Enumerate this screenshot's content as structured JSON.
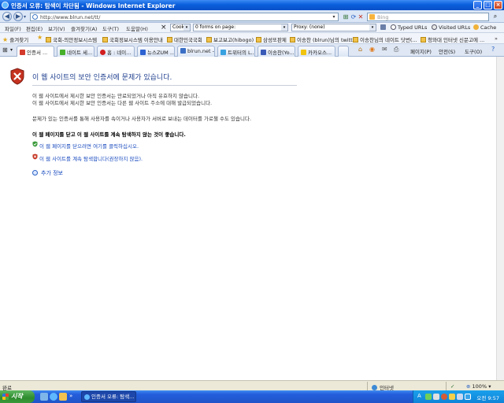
{
  "window": {
    "title": "인증서 오류: 탐색이 차단됨 - Windows Internet Explorer"
  },
  "address_bar": {
    "url": "http://www.blrun.net/tt/",
    "search_placeholder": "Bing"
  },
  "menu": [
    "파일(F)",
    "편집(E)",
    "보기(V)",
    "즐겨찾기(A)",
    "도구(T)",
    "도움말(H)"
  ],
  "toolbar": {
    "cookie_combo": "Cookie",
    "forms_combo": "0 forms on page:",
    "proxy_combo": "Proxy: (none)",
    "typed_urls": "Typed URLs",
    "visited_urls": "Visited URLs",
    "cache": "Cache"
  },
  "favorites": {
    "label": "즐겨찾기",
    "items": [
      "국회-의안정보시스템",
      "국회정보시스템 이용안내",
      "대한민국국회",
      "보고보고(hibogo)",
      "삼성또판제",
      "이송찬 (blrun)님의 twitter",
      "이송찬님의 네이트 닷번(...",
      "청와대 인터넷 신문고에 ..."
    ]
  },
  "tabs": [
    {
      "label": "인증서 ...",
      "color": "#d33a2c"
    },
    {
      "label": "네이트 세...",
      "color": "#47b02b"
    },
    {
      "label": "홈 : 네이...",
      "color": "#d21e1e"
    },
    {
      "label": "뉴스ZUM ...",
      "color": "#2c62d2"
    },
    {
      "label": "blrun.net -...",
      "color": "#3a6fc6"
    },
    {
      "label": "트위터의 L...",
      "color": "#38a1e0"
    },
    {
      "label": "이송찬(Yo...",
      "color": "#3a5ab8"
    },
    {
      "label": "카카오스...",
      "color": "#f1c40f"
    }
  ],
  "commands": {
    "page": "페이지(P)",
    "safety": "안전(S)",
    "tools": "도구(O)"
  },
  "error_page": {
    "title": "이 웹 사이트의 보안 인증서에 문제가 있습니다.",
    "line1": "이 웹 사이트에서 제시한 보안 인증서는 만료되었거나 아직 유효하지 않습니다.",
    "line2": "이 웹 사이트에서 제시한 보안 인증서는 다른 웹 사이트 주소에 대해 발급되었습니다.",
    "line3": "문제가 있는 인증서를 통해 사용자를 속이거나 사용자가 서버로 보내는 데이터를 가로챌 수도 있습니다.",
    "recommend": "이 웹 페이지를 닫고 이 웹 사이트를 계속 탐색하지 않는 것이 좋습니다.",
    "close_link": "이 웹 페이지를 닫으려면 여기를 클릭하십시오.",
    "continue_link": "이 웹 사이트를 계속 탐색합니다(권장하지 않음).",
    "more_info": "추가 정보"
  },
  "status_bar": {
    "left": "완료",
    "zone": "인터넷",
    "zoom": "100%"
  },
  "taskbar": {
    "start": "시작",
    "task_label": "인증서 오류: 탐색...",
    "clock": "오전 9:57"
  }
}
